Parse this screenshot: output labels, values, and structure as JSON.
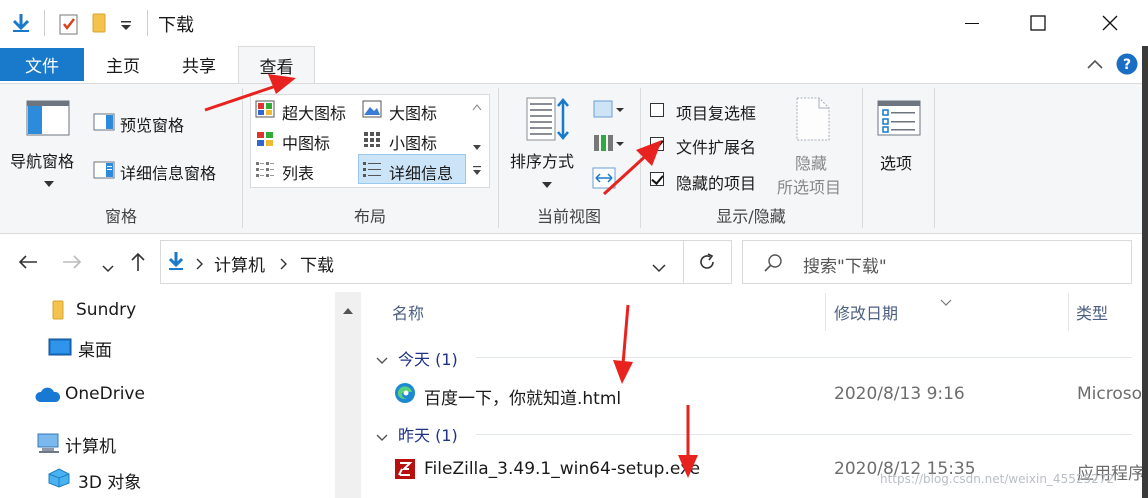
{
  "window": {
    "title": "下载",
    "colors": {
      "accent": "#1979ca",
      "ribbon_bg": "#f5f6f7",
      "arrow_red": "#e8231f",
      "help": "#1b6fc3"
    }
  },
  "tabs": {
    "file": "文件",
    "home": "主页",
    "share": "共享",
    "view": "查看"
  },
  "ribbon": {
    "panes": {
      "nav_pane": "导航窗格",
      "preview_pane": "预览窗格",
      "details_pane": "详细信息窗格",
      "label": "窗格"
    },
    "layout": {
      "extra_large": "超大图标",
      "large": "大图标",
      "medium": "中图标",
      "small": "小图标",
      "list": "列表",
      "details": "详细信息",
      "label": "布局"
    },
    "current_view": {
      "sort_by": "排序方式",
      "label": "当前视图"
    },
    "show_hide": {
      "item_checkboxes": {
        "label": "项目复选框",
        "checked": false
      },
      "file_extensions": {
        "label": "文件扩展名",
        "checked": true
      },
      "hidden_items": {
        "label": "隐藏的项目",
        "checked": true
      },
      "hide_selected_1": "隐藏",
      "hide_selected_2": "所选项目",
      "label": "显示/隐藏"
    },
    "options": "选项"
  },
  "address": {
    "crumb_1": "计算机",
    "crumb_2": "下载"
  },
  "search": {
    "placeholder": "搜索\"下载\""
  },
  "nav_tree": {
    "sundry": "Sundry",
    "desktop": "桌面",
    "onedrive": "OneDrive",
    "computer": "计算机",
    "objects3d": "3D 对象"
  },
  "columns": {
    "name": "名称",
    "modified": "修改日期",
    "type": "类型"
  },
  "groups": [
    {
      "label": "今天 (1)",
      "files": [
        {
          "name": "百度一下，你就知道.html",
          "modified": "2020/8/13 9:16",
          "type": "Microso",
          "icon": "edge-icon"
        }
      ]
    },
    {
      "label": "昨天 (1)",
      "files": [
        {
          "name": "FileZilla_3.49.1_win64-setup.exe",
          "modified": "2020/8/12 15:35",
          "type": "应用程序",
          "icon": "filezilla-icon"
        }
      ]
    }
  ],
  "watermark": "https://blog.csdn.net/weixin_45525272"
}
